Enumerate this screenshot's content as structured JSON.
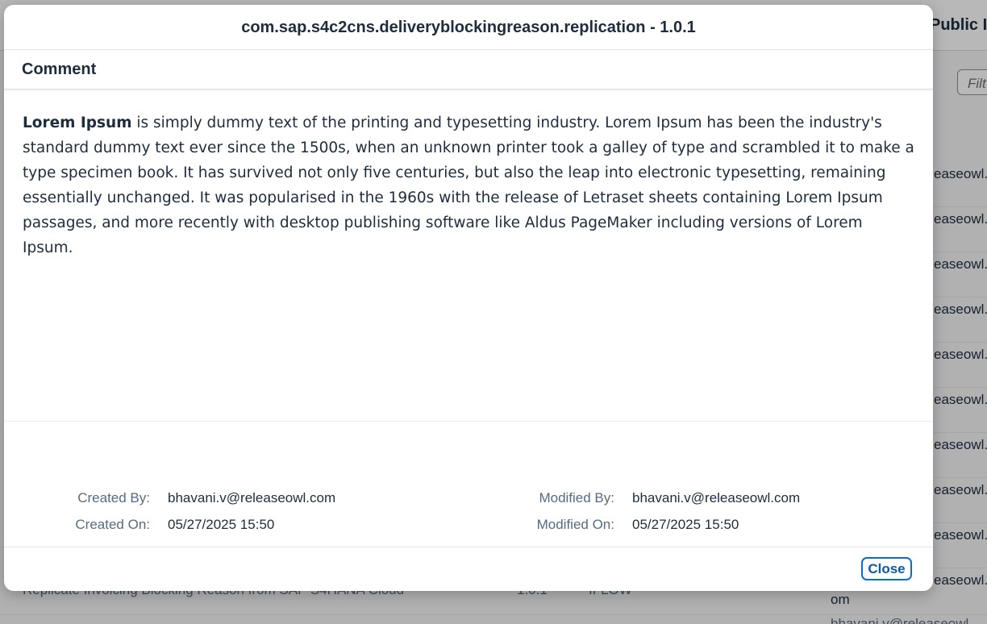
{
  "background": {
    "page_title_fragment": "Public I",
    "filter_placeholder": "Filt",
    "row_fragments": [
      "easeowl.",
      "easeowl.",
      "easeowl.",
      "easeowl.",
      "easeowl.",
      "easeowl.",
      "easeowl.",
      "easeowl.",
      "easeowl.",
      "easeowl."
    ],
    "row_tail_fragment": "om",
    "bottom_row": {
      "name": "Replicate Invoicing Blocking Reason from SAP S4HANA Cloud",
      "version": "1.0.1",
      "type": "IFLOW",
      "owner_fragment": "bhavani.v@releaseowl"
    }
  },
  "dialog": {
    "title": "com.sap.s4c2cns.deliveryblockingreason.replication - 1.0.1",
    "section_title": "Comment",
    "comment": {
      "bold_lead": "Lorem Ipsum",
      "body": " is simply dummy text of the printing and typesetting industry. Lorem Ipsum has been the industry's standard dummy text ever since the 1500s, when an unknown printer took a galley of type and scrambled it to make a type specimen book. It has survived not only five centuries, but also the leap into electronic typesetting, remaining essentially unchanged. It was popularised in the 1960s with the release of Letraset sheets containing Lorem Ipsum passages, and more recently with desktop publishing software like Aldus PageMaker including versions of Lorem Ipsum."
    },
    "meta": {
      "created_by_label": "Created By:",
      "created_by": "bhavani.v@releaseowl.com",
      "created_on_label": "Created On:",
      "created_on": "05/27/2025 15:50",
      "modified_by_label": "Modified By:",
      "modified_by": "bhavani.v@releaseowl.com",
      "modified_on_label": "Modified On:",
      "modified_on": "05/27/2025 15:50"
    },
    "close_label": "Close"
  }
}
